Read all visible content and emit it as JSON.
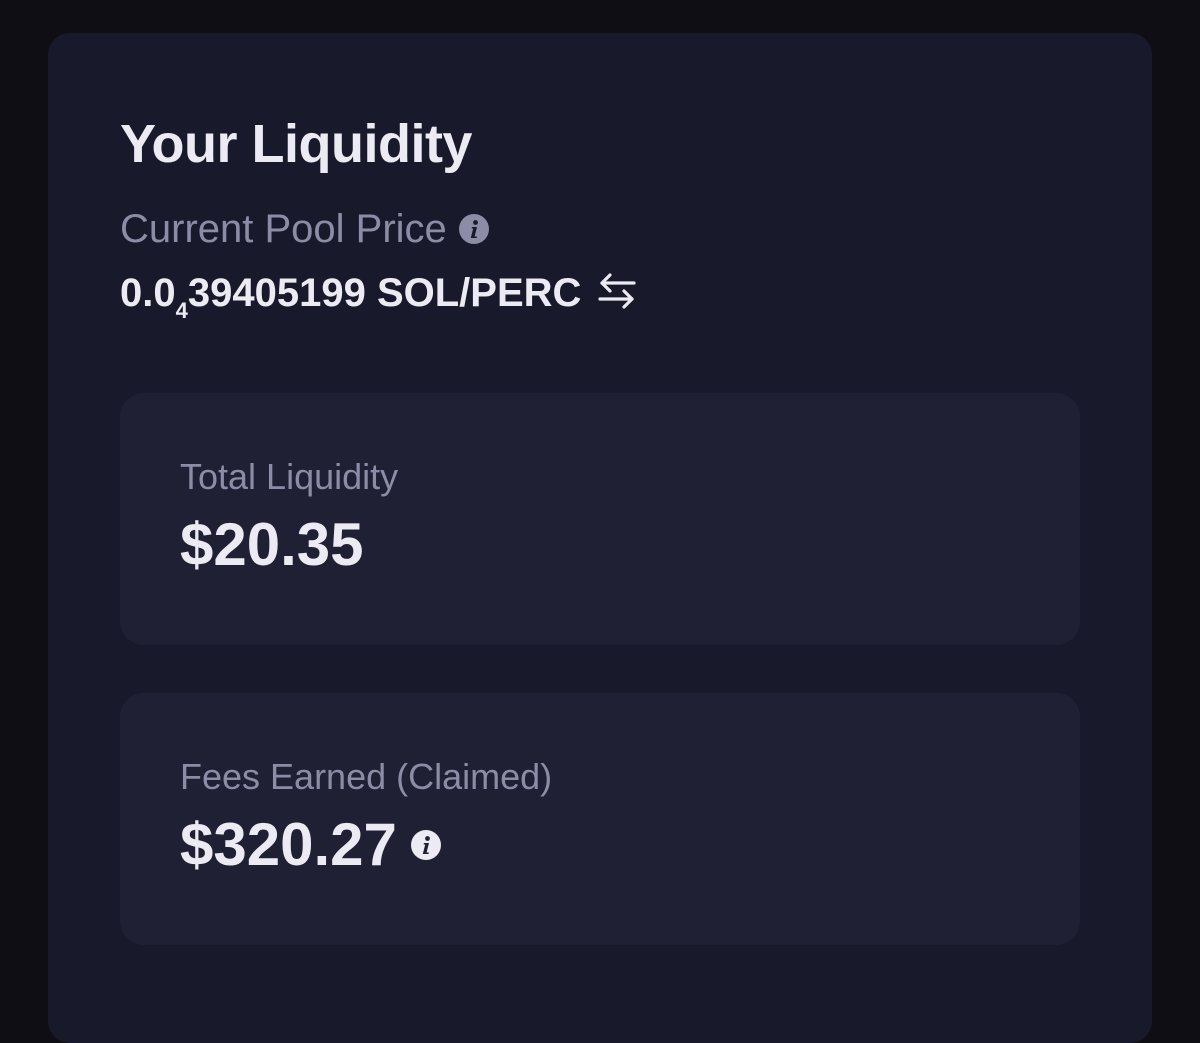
{
  "liquidity": {
    "title": "Your Liquidity",
    "pool_price": {
      "label": "Current Pool Price",
      "value_prefix": "0.0",
      "value_subscript": "4",
      "value_suffix": "39405199 SOL/PERC",
      "info_icon": "info-icon",
      "swap_icon": "swap-arrows-icon"
    },
    "total_liquidity": {
      "label": "Total Liquidity",
      "value": "$20.35"
    },
    "fees_earned": {
      "label": "Fees Earned (Claimed)",
      "value": "$320.27",
      "info_icon": "info-icon"
    }
  },
  "colors": {
    "page_background": "#0e0e14",
    "panel_background": "#181a2c",
    "card_background": "#1f2034",
    "primary_text": "#ecebf3",
    "muted_text": "#8c8ca6"
  }
}
